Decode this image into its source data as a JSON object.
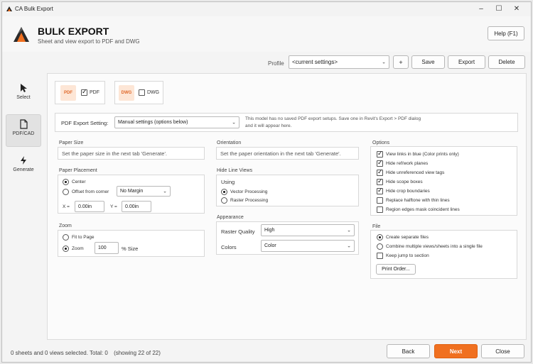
{
  "window": {
    "title": "CA Bulk Export"
  },
  "header": {
    "title": "BULK EXPORT",
    "subtitle": "Sheet and view export to PDF and DWG",
    "help_label": "Help (F1)"
  },
  "toolbar": {
    "profile_label": "Profile",
    "profile_value": "<current settings>",
    "add_label": "+",
    "save_label": "Save",
    "export_label": "Export",
    "delete_label": "Delete"
  },
  "sidebar": {
    "items": [
      {
        "label": "Select",
        "icon": "cursor-icon",
        "active": false
      },
      {
        "label": "PDF/CAD",
        "icon": "document-icon",
        "active": true
      },
      {
        "label": "Generate",
        "icon": "lightning-icon",
        "active": false
      }
    ]
  },
  "formats": {
    "pdf": {
      "icon_text": "PDF",
      "label": "PDF",
      "checked": true
    },
    "dwg": {
      "icon_text": "DWG",
      "label": "DWG",
      "checked": false
    }
  },
  "pdf_export_setting": {
    "label": "PDF Export Setting:",
    "value": "Manual settings (options below)",
    "note_line1": "This model has no saved PDF export setups. Save one in Revit's Export > PDF dialog",
    "note_line2": "and it will appear here."
  },
  "paper_size": {
    "title": "Paper Size",
    "hint": "Set the paper size in the next tab 'Generate'."
  },
  "orientation": {
    "title": "Orientation",
    "hint": "Set the paper orientation in the next tab 'Generate'."
  },
  "paper_placement": {
    "title": "Paper Placement",
    "center_label": "Center",
    "offset_label": "Offset from corner",
    "margin_value": "No Margin",
    "x_label": "X =",
    "x_value": "0.00in",
    "y_label": "Y =",
    "y_value": "0.00in",
    "selected": "center"
  },
  "hide_line_views": {
    "title": "Hide Line Views",
    "using_label": "Using",
    "vector_label": "Vector Processing",
    "raster_label": "Raster Processing",
    "selected": "vector"
  },
  "zoom": {
    "title": "Zoom",
    "fit_label": "Fit to Page",
    "zoom_label": "Zoom",
    "zoom_value": "100",
    "size_label": "% Size",
    "selected": "zoom"
  },
  "appearance": {
    "title": "Appearance",
    "raster_label": "Raster Quality",
    "raster_value": "High",
    "colors_label": "Colors",
    "colors_value": "Color"
  },
  "options": {
    "title": "Options",
    "items": [
      {
        "label": "View links in blue (Color prints only)",
        "checked": true
      },
      {
        "label": "Hide ref/work planes",
        "checked": true
      },
      {
        "label": "Hide unreferenced view tags",
        "checked": true
      },
      {
        "label": "Hide scope boxes",
        "checked": true
      },
      {
        "label": "Hide crop boundaries",
        "checked": true
      },
      {
        "label": "Replace halftone with thin lines",
        "checked": false
      },
      {
        "label": "Region edges mask coincident lines",
        "checked": false
      }
    ]
  },
  "file": {
    "title": "File",
    "separate_label": "Create separate files",
    "combine_label": "Combine multiple views/sheets into a single file",
    "keep_jump_label": "Keep jump to section",
    "print_order_label": "Print Order...",
    "selected": "separate",
    "keep_jump_checked": false
  },
  "footer": {
    "status": "0 sheets and 0 views selected. Total: 0",
    "showing": "(showing 22 of 22)",
    "back_label": "Back",
    "next_label": "Next",
    "close_label": "Close"
  },
  "colors": {
    "accent": "#f07020"
  }
}
